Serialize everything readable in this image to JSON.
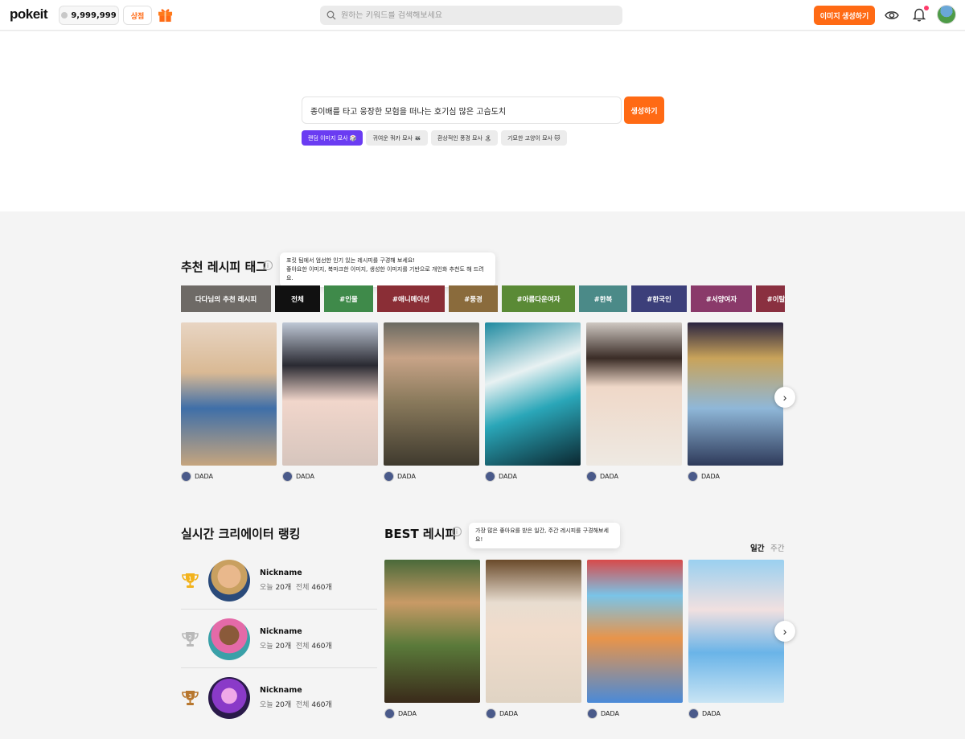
{
  "header": {
    "logo": "pokeit",
    "points": "9,999,999",
    "shop": "상점",
    "search_placeholder": "원하는 키워드를 검색해보세요",
    "create_button": "이미지 생성하기"
  },
  "hero": {
    "prompt_value": "종이배를 타고 웅장한 모험을 떠나는 호기심 많은 고슴도치",
    "generate_button": "생성하기",
    "chips": [
      {
        "label": "랜덤 이미지 묘사 🎲",
        "active": true
      },
      {
        "label": "귀여운 쿼카 묘사 🦝",
        "active": false
      },
      {
        "label": "환상적인 풍경 묘사 🏝",
        "active": false
      },
      {
        "label": "기묘한 고양이 묘사 🐱",
        "active": false
      }
    ]
  },
  "recommend": {
    "title": "추천 레시피 태그",
    "tooltip_line1": "포킷 팀에서 엄선한 인기 있는 레시피를 구경해 보세요!",
    "tooltip_line2": "좋아요한 이미지, 북마크한 이미지, 생성한 이미지를 기반으로 개인화 추천도 해 드려요.",
    "tags": [
      {
        "label": "다다님의 추천 레시피",
        "color": "#6e6a66"
      },
      {
        "label": "전체",
        "color": "#111111"
      },
      {
        "label": "#인물",
        "color": "#3f8a4a"
      },
      {
        "label": "#애니메이션",
        "color": "#8a2e36"
      },
      {
        "label": "#풍경",
        "color": "#8a6b3c"
      },
      {
        "label": "#아름다운여자",
        "color": "#5a8a36"
      },
      {
        "label": "#한복",
        "color": "#4b8a88"
      },
      {
        "label": "#한국인",
        "color": "#3c3f7a"
      },
      {
        "label": "#서양여자",
        "color": "#8a3a6a"
      },
      {
        "label": "#이탈",
        "color": "#8a3040"
      }
    ],
    "cards": [
      {
        "author": "DADA"
      },
      {
        "author": "DADA"
      },
      {
        "author": "DADA"
      },
      {
        "author": "DADA"
      },
      {
        "author": "DADA"
      },
      {
        "author": "DADA"
      }
    ]
  },
  "ranking": {
    "title": "실시간 크리에이터 랭킹",
    "rows": [
      {
        "rank": "1",
        "nickname": "Nickname",
        "today_label": "오늘",
        "today_value": "20개",
        "total_label": "전체",
        "total_value": "460개",
        "trophy_color": "#f2b21c"
      },
      {
        "rank": "2",
        "nickname": "Nickname",
        "today_label": "오늘",
        "today_value": "20개",
        "total_label": "전체",
        "total_value": "460개",
        "trophy_color": "#b9b9b9"
      },
      {
        "rank": "3",
        "nickname": "Nickname",
        "today_label": "오늘",
        "today_value": "20개",
        "total_label": "전체",
        "total_value": "460개",
        "trophy_color": "#b8772e"
      }
    ]
  },
  "best": {
    "title": "BEST 레시피",
    "tooltip": "가장 많은 좋아요를 받은 일간, 주간 레시피를 구경해보세요!",
    "period_daily": "일간",
    "period_weekly": "주간",
    "cards": [
      {
        "author": "DADA"
      },
      {
        "author": "DADA"
      },
      {
        "author": "DADA"
      },
      {
        "author": "DADA"
      }
    ]
  },
  "colors": {
    "accent": "#ff6a14",
    "chip_active": "#6a3cf2"
  }
}
